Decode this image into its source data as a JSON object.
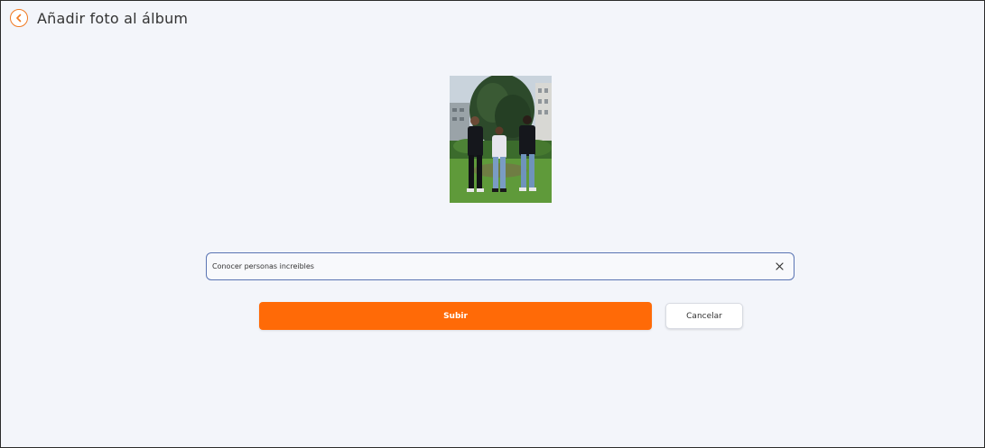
{
  "header": {
    "title": "Añadir foto al álbum",
    "back_icon": "chevron-left-icon"
  },
  "colors": {
    "accent": "#ff6a07",
    "background": "#f3f5fa",
    "field_border": "#5a74b3"
  },
  "photo": {
    "subject": "three people standing outdoors in front of a tree"
  },
  "caption": {
    "value": "Conocer personas increibles",
    "clear_icon": "close-icon"
  },
  "actions": {
    "submit_label": "Subir",
    "cancel_label": "Cancelar"
  }
}
